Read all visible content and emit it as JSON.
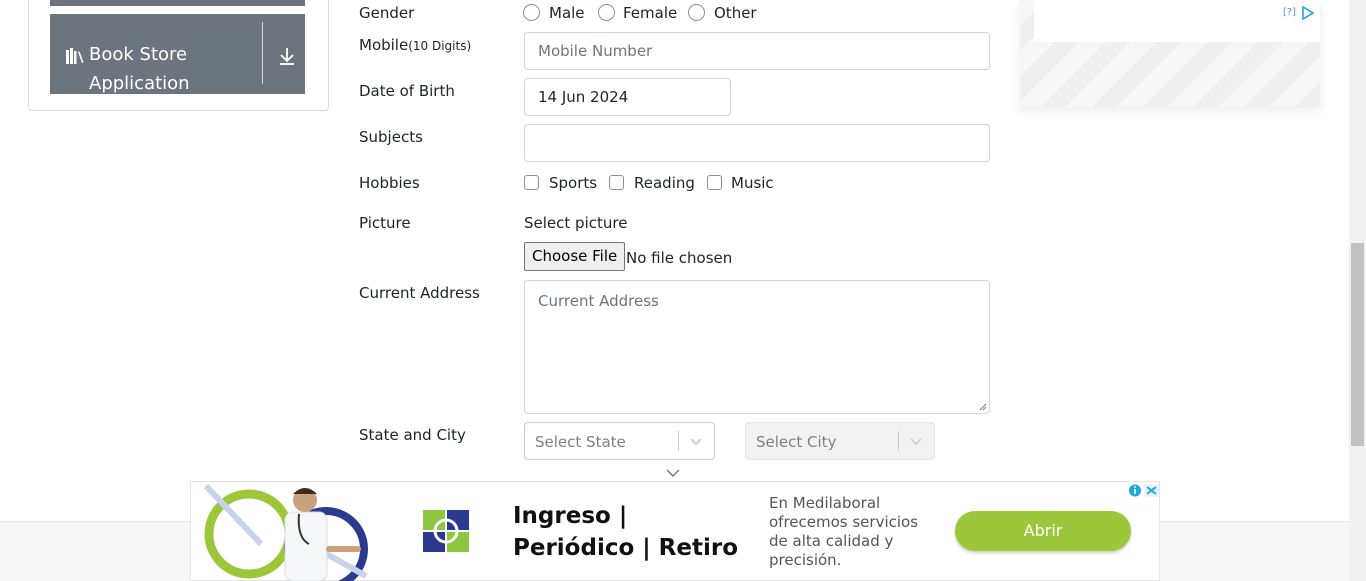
{
  "sidebar": {
    "item_label": "Book Store Application"
  },
  "form": {
    "gender_label": "Gender",
    "gender_options": [
      "Male",
      "Female",
      "Other"
    ],
    "mobile_label": "Mobile",
    "mobile_hint": "(10 Digits)",
    "mobile_placeholder": "Mobile Number",
    "dob_label": "Date of Birth",
    "dob_value": "14 Jun 2024",
    "subjects_label": "Subjects",
    "hobbies_label": "Hobbies",
    "hobby_options": [
      "Sports",
      "Reading",
      "Music"
    ],
    "picture_label": "Picture",
    "picture_caption": "Select picture",
    "file_button": "Choose File",
    "file_status": "No file chosen",
    "address_label": "Current Address",
    "address_placeholder": "Current Address",
    "state_city_label": "State and City",
    "state_placeholder": "Select State",
    "city_placeholder": "Select City"
  },
  "ad_right": {
    "info_mark": "[?]"
  },
  "ad_bottom": {
    "title": "Ingreso | Periódico | Retiro",
    "description": "En Medilaboral ofrecemos servicios de alta calidad y precisión.",
    "button": "Abrir"
  },
  "colors": {
    "sidebar_bg": "#6c757d",
    "ad_button": "#9dc73a",
    "ad_logo_blue": "#2b3a8f",
    "ad_logo_green": "#8dc63f"
  }
}
